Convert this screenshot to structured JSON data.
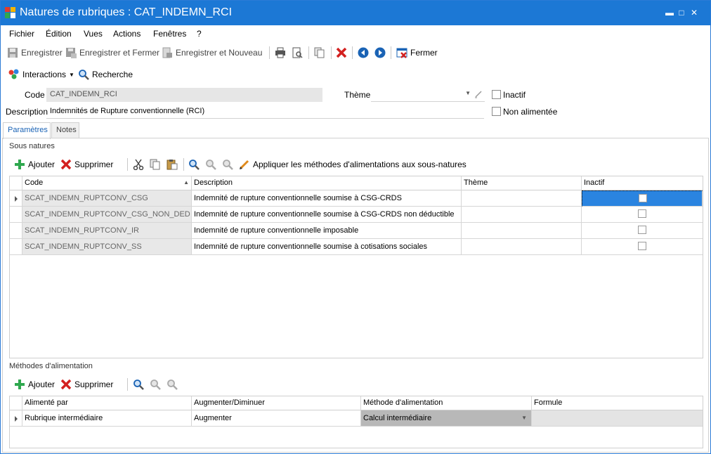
{
  "window": {
    "title": "Natures de rubriques : CAT_INDEMN_RCI",
    "minimize": "▬",
    "maximize": "□",
    "close": "✕"
  },
  "menu": [
    "Fichier",
    "Édition",
    "Vues",
    "Actions",
    "Fenêtres",
    "?"
  ],
  "toolbar": {
    "save": "Enregistrer",
    "save_close": "Enregistrer et Fermer",
    "save_new": "Enregistrer et Nouveau",
    "close": "Fermer"
  },
  "toolbar2": {
    "interactions": "Interactions",
    "search": "Recherche"
  },
  "form": {
    "code_label": "Code",
    "code_value": "CAT_INDEMN_RCI",
    "theme_label": "Thème",
    "theme_value": "",
    "inactive_label": "Inactif",
    "description_label": "Description",
    "description_value": "Indemnités de Rupture conventionnelle (RCI)",
    "not_fed_label": "Non alimentée"
  },
  "tabs": [
    "Paramètres",
    "Notes"
  ],
  "subnatures": {
    "title": "Sous natures",
    "add": "Ajouter",
    "delete": "Supprimer",
    "apply": "Appliquer les méthodes d'alimentations aux sous-natures",
    "columns": [
      "Code",
      "Description",
      "Thème",
      "Inactif"
    ],
    "rows": [
      {
        "code": "SCAT_INDEMN_RUPTCONV_CSG",
        "description": "Indemnité de rupture conventionnelle soumise à CSG-CRDS",
        "theme": "",
        "inactive": false
      },
      {
        "code": "SCAT_INDEMN_RUPTCONV_CSG_NON_DED",
        "description": "Indemnité de rupture conventionnelle soumise à CSG-CRDS non déductible",
        "theme": "",
        "inactive": false
      },
      {
        "code": "SCAT_INDEMN_RUPTCONV_IR",
        "description": "Indemnité de rupture conventionnelle imposable",
        "theme": "",
        "inactive": false
      },
      {
        "code": "SCAT_INDEMN_RUPTCONV_SS",
        "description": "Indemnité de rupture conventionnelle soumise à cotisations sociales",
        "theme": "",
        "inactive": false
      }
    ]
  },
  "methods": {
    "title": "Méthodes d'alimentation",
    "add": "Ajouter",
    "delete": "Supprimer",
    "columns": [
      "Alimenté par",
      "Augmenter/Diminuer",
      "Méthode d'alimentation",
      "Formule"
    ],
    "rows": [
      {
        "source": "Rubrique intermédiaire",
        "direction": "Augmenter",
        "method": "Calcul intermédiaire",
        "formula": ""
      }
    ]
  },
  "colors": {
    "titlebar": "#1c78d5",
    "selection": "#2a84e0",
    "active_tab": "#1a63b5"
  }
}
